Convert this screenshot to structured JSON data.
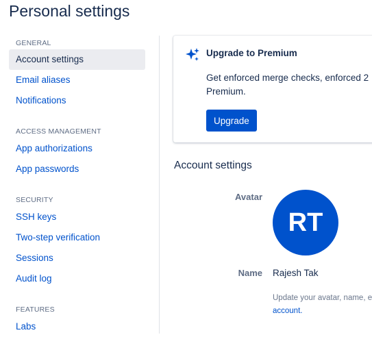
{
  "page": {
    "title": "Personal settings"
  },
  "sidebar": {
    "groups": [
      {
        "heading": "GENERAL",
        "items": [
          "Account settings",
          "Email aliases",
          "Notifications"
        ]
      },
      {
        "heading": "ACCESS MANAGEMENT",
        "items": [
          "App authorizations",
          "App passwords"
        ]
      },
      {
        "heading": "SECURITY",
        "items": [
          "SSH keys",
          "Two-step verification",
          "Sessions",
          "Audit log"
        ]
      },
      {
        "heading": "FEATURES",
        "items": [
          "Labs"
        ]
      }
    ],
    "selected": "Account settings"
  },
  "premium": {
    "icon": "sparkle-icon",
    "title": "Upgrade to Premium",
    "description": "Get enforced merge checks, enforced 2 Premium.",
    "button_label": "Upgrade"
  },
  "account": {
    "section_title": "Account settings",
    "avatar_label": "Avatar",
    "avatar_initials": "RT",
    "name_label": "Name",
    "name_value": "Rajesh Tak",
    "help_text": "Update your avatar, name, e",
    "help_link": "account."
  },
  "colors": {
    "accent": "#0052cc",
    "text": "#172b4d",
    "muted": "#5e6c84",
    "selected_bg": "#ebecf0"
  }
}
